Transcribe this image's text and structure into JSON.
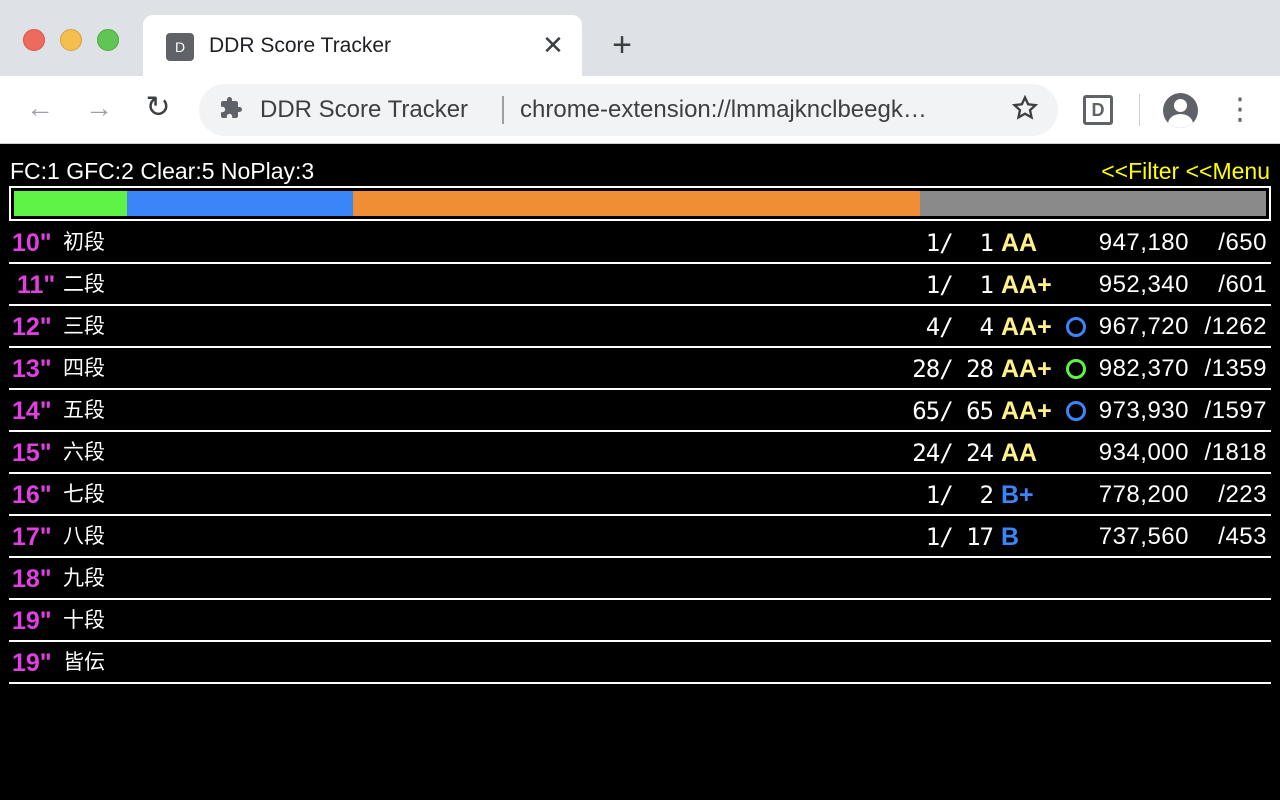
{
  "browser": {
    "tab": {
      "favicon": "D",
      "title": "DDR Score Tracker",
      "close_glyph": "✕"
    },
    "new_tab_glyph": "+",
    "toolbar": {
      "back_icon": "←",
      "forward_icon": "→",
      "reload_icon": "↻",
      "omnibox_name": "DDR Score Tracker",
      "omnibox_url": "chrome-extension://lmmajknclbeegk…",
      "extension_badge": "D",
      "menu_glyph": "⋮"
    }
  },
  "summary": {
    "text": "FC:1 GFC:2 Clear:5 NoPlay:3",
    "filter_link": "<<Filter",
    "menu_link": "<<Menu"
  },
  "progress": [
    {
      "label": "GFC",
      "fraction": 0.0906,
      "color": "#5ef346"
    },
    {
      "label": "FC",
      "fraction": 0.1804,
      "color": "#3a85f7"
    },
    {
      "label": "Clear",
      "fraction": 0.453,
      "color": "#f08e35"
    },
    {
      "label": "NoPlay",
      "fraction": 0.276,
      "color": "#8a8a8a"
    }
  ],
  "colors": {
    "level": "#e040e0",
    "rank_gold": "#fff28a",
    "rank_blue": "#3a85f7",
    "lamp_blue": "#3a85f7",
    "lamp_green": "#5ef346",
    "link_yellow": "#ffff00"
  },
  "rows": [
    {
      "level": "10\"",
      "dan": "初段",
      "count": " 1/  1",
      "rank": "AA",
      "rank_color": "#fff28a",
      "lamp": null,
      "score": "947,180",
      "total": "/650"
    },
    {
      "level": "11\"",
      "dan": "二段",
      "count": " 1/  1",
      "rank": "AA+",
      "rank_color": "#fff28a",
      "lamp": null,
      "score": "952,340",
      "total": "/601"
    },
    {
      "level": "12\"",
      "dan": "三段",
      "count": " 4/  4",
      "rank": "AA+",
      "rank_color": "#fff28a",
      "lamp": "#3a85f7",
      "score": "967,720",
      "total": "/1262"
    },
    {
      "level": "13\"",
      "dan": "四段",
      "count": "28/ 28",
      "rank": "AA+",
      "rank_color": "#fff28a",
      "lamp": "#5ef346",
      "score": "982,370",
      "total": "/1359"
    },
    {
      "level": "14\"",
      "dan": "五段",
      "count": "65/ 65",
      "rank": "AA+",
      "rank_color": "#fff28a",
      "lamp": "#3a85f7",
      "score": "973,930",
      "total": "/1597"
    },
    {
      "level": "15\"",
      "dan": "六段",
      "count": "24/ 24",
      "rank": "AA",
      "rank_color": "#fff28a",
      "lamp": null,
      "score": "934,000",
      "total": "/1818"
    },
    {
      "level": "16\"",
      "dan": "七段",
      "count": " 1/  2",
      "rank": "B+",
      "rank_color": "#3a85f7",
      "lamp": null,
      "score": "778,200",
      "total": "/223"
    },
    {
      "level": "17\"",
      "dan": "八段",
      "count": " 1/ 17",
      "rank": "B",
      "rank_color": "#3a85f7",
      "lamp": null,
      "score": "737,560",
      "total": "/453"
    },
    {
      "level": "18\"",
      "dan": "九段",
      "count": "",
      "rank": "",
      "rank_color": "",
      "lamp": null,
      "score": "",
      "total": ""
    },
    {
      "level": "19\"",
      "dan": "十段",
      "count": "",
      "rank": "",
      "rank_color": "",
      "lamp": null,
      "score": "",
      "total": ""
    },
    {
      "level": "19\"",
      "dan": "皆伝",
      "count": "",
      "rank": "",
      "rank_color": "",
      "lamp": null,
      "score": "",
      "total": ""
    }
  ]
}
